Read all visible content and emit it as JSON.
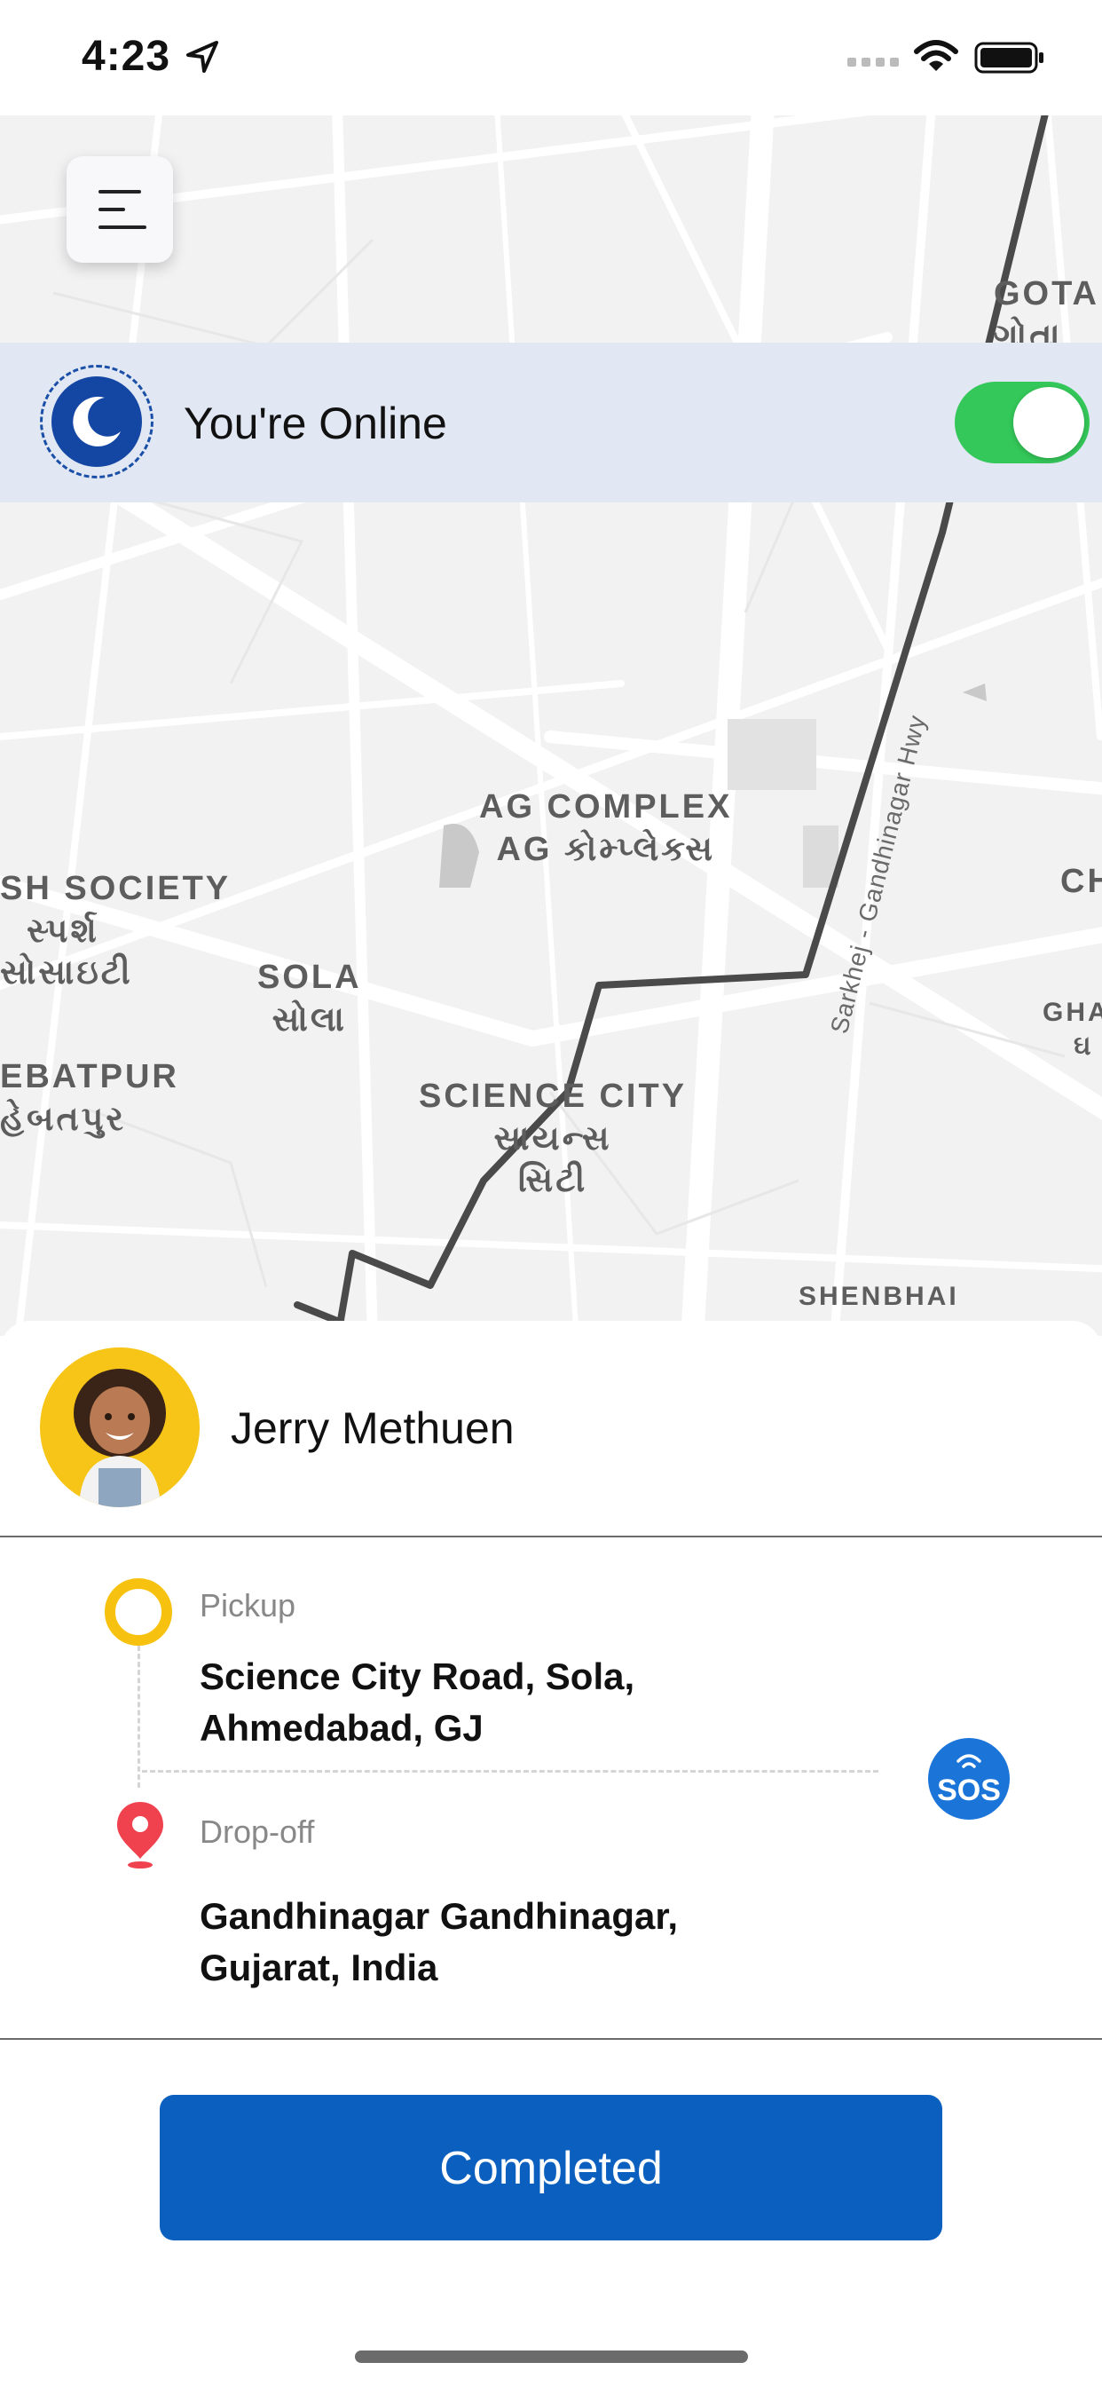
{
  "status_bar": {
    "time": "4:23",
    "icons": [
      "location-arrow-icon",
      "signal-dots-icon",
      "wifi-icon",
      "battery-icon"
    ]
  },
  "map": {
    "labels": [
      {
        "en": "GOTA",
        "gu": "ગોતા"
      },
      {
        "en": "AG COMPLEX",
        "gu": "AG કોમ્પ્લેક્સ"
      },
      {
        "en": "SH SOCIETY",
        "gu": "સ્પર્શ"
      },
      {
        "en": "",
        "gu": "સોસાઇટી"
      },
      {
        "en": "SOLA",
        "gu": "સોલા"
      },
      {
        "en": "EBATPUR",
        "gu": "હેબતપુર"
      },
      {
        "en": "SCIENCE CITY",
        "gu": "સાયન્સ"
      },
      {
        "en": "",
        "gu": "સિટી"
      },
      {
        "en": "CH",
        "gu": ""
      },
      {
        "en": "GHA",
        "gu": "ઘ"
      },
      {
        "en": "SHENBHAI",
        "gu": ""
      }
    ],
    "road_label": "Sarkhej - Gandhinagar Hwy",
    "route_color": "#4a4a4a"
  },
  "menu": {
    "icon": "hamburger-menu-icon"
  },
  "online": {
    "text": "You're Online",
    "icon": "moon-icon",
    "toggle_on": true,
    "toggle_color": "#34c759"
  },
  "rider": {
    "name": "Jerry Methuen",
    "avatar": "avatar-child-photo"
  },
  "trip": {
    "pickup_label": "Pickup",
    "pickup_address": "Science City Road, Sola, Ahmedabad, GJ",
    "pickup_line1": "Science City Road, Sola,",
    "pickup_line2": "Ahmedabad, GJ",
    "dropoff_label": "Drop-off",
    "dropoff_line1": "Gandhinagar Gandhinagar,",
    "dropoff_line2": "Gujarat, India",
    "pickup_color": "#f7c20f",
    "dropoff_color": "#f0424e"
  },
  "sos": {
    "label": "SOS",
    "color": "#1b74d8"
  },
  "action": {
    "label": "Completed",
    "color": "#0a5fbf"
  }
}
